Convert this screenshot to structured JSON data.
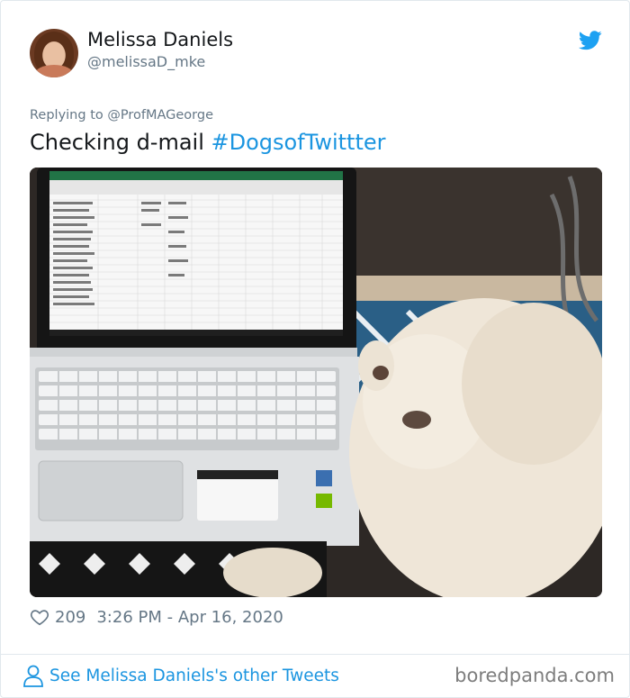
{
  "author": {
    "name": "Melissa Daniels",
    "handle": "@melissaD_mke",
    "avatar_icon": "profile-photo"
  },
  "tweet": {
    "replying_to": "Replying to @ProfMAGeorge",
    "text": "Checking d-mail ",
    "hashtag": "#DogsofTwittter",
    "photo_icon": "laptop-and-dog-photo"
  },
  "stats": {
    "likes": "209",
    "timestamp": "3:26 PM - Apr 16, 2020"
  },
  "footer": {
    "other_tweets_label": "See Melissa Daniels's other Tweets",
    "watermark": "boredpanda.com"
  },
  "colors": {
    "twitter_blue": "#1b95e0",
    "secondary_text": "#657786",
    "border": "#e1e8ed"
  }
}
